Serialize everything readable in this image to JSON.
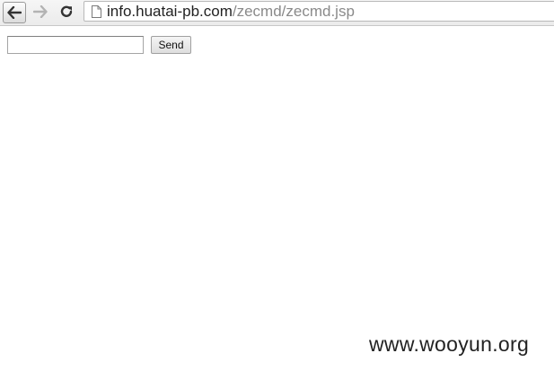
{
  "browser": {
    "url_host": "info.huatai-pb.com",
    "url_path": "/zecmd/zecmd.jsp",
    "back_icon": "arrow-left-icon",
    "forward_icon": "arrow-right-icon",
    "reload_icon": "reload-icon",
    "page_icon": "page-icon"
  },
  "form": {
    "input_value": "",
    "send_label": "Send"
  },
  "watermark": {
    "text": "www.wooyun.org"
  }
}
